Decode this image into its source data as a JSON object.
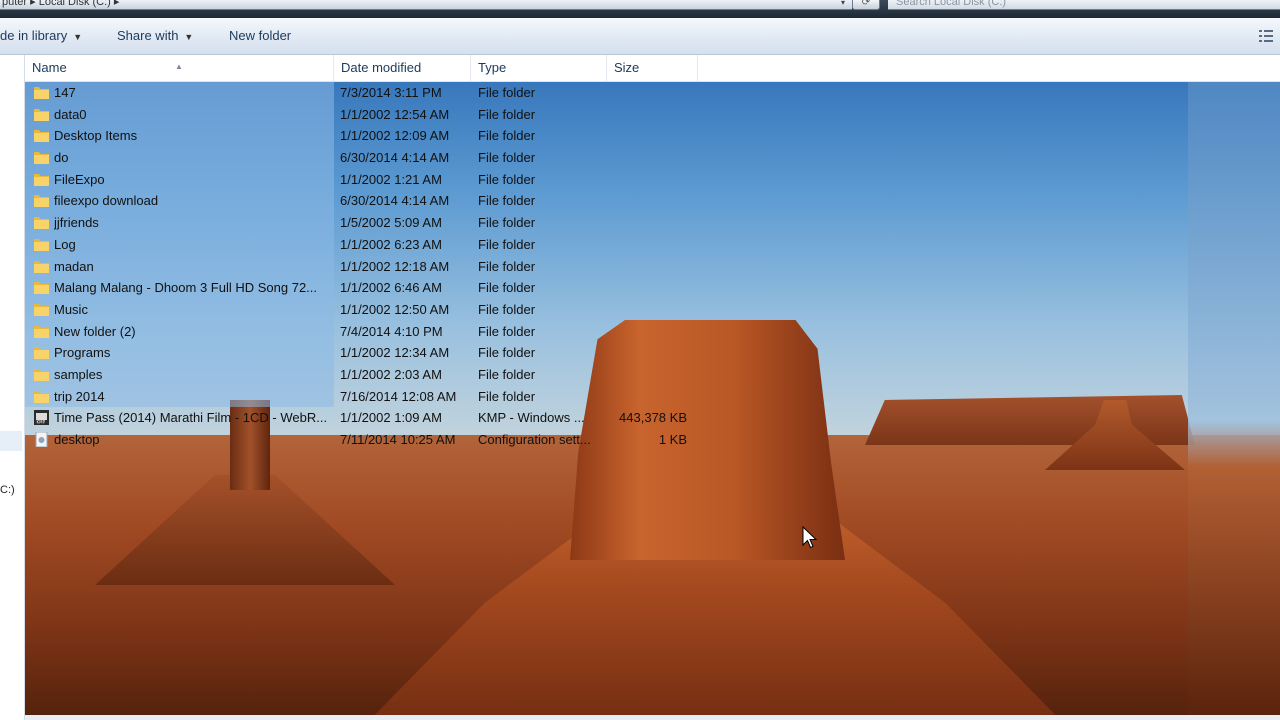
{
  "address": {
    "path_text": "puter ▸ Local Disk (C:) ▸",
    "search_placeholder": "Search Local Disk (C:)"
  },
  "toolbar": {
    "include_label": "de in library",
    "share_label": "Share with",
    "new_folder_label": "New folder"
  },
  "nav": {
    "drive_text": "C:)"
  },
  "columns": {
    "name": "Name",
    "date": "Date modified",
    "type": "Type",
    "size": "Size"
  },
  "files": [
    {
      "name": "147",
      "date": "7/3/2014 3:11 PM",
      "type": "File folder",
      "size": "",
      "icon": "folder-icon"
    },
    {
      "name": "data0",
      "date": "1/1/2002 12:54 AM",
      "type": "File folder",
      "size": "",
      "icon": "folder-icon"
    },
    {
      "name": "Desktop Items",
      "date": "1/1/2002 12:09 AM",
      "type": "File folder",
      "size": "",
      "icon": "folder-icon"
    },
    {
      "name": "do",
      "date": "6/30/2014 4:14 AM",
      "type": "File folder",
      "size": "",
      "icon": "folder-icon"
    },
    {
      "name": "FileExpo",
      "date": "1/1/2002 1:21 AM",
      "type": "File folder",
      "size": "",
      "icon": "folder-icon"
    },
    {
      "name": "fileexpo download",
      "date": "6/30/2014 4:14 AM",
      "type": "File folder",
      "size": "",
      "icon": "folder-icon"
    },
    {
      "name": "jjfriends",
      "date": "1/5/2002 5:09 AM",
      "type": "File folder",
      "size": "",
      "icon": "folder-icon"
    },
    {
      "name": "Log",
      "date": "1/1/2002 6:23 AM",
      "type": "File folder",
      "size": "",
      "icon": "folder-icon"
    },
    {
      "name": "madan",
      "date": "1/1/2002 12:18 AM",
      "type": "File folder",
      "size": "",
      "icon": "folder-icon"
    },
    {
      "name": "Malang Malang - Dhoom 3 Full HD Song 72...",
      "date": "1/1/2002 6:46 AM",
      "type": "File folder",
      "size": "",
      "icon": "folder-icon"
    },
    {
      "name": "Music",
      "date": "1/1/2002 12:50 AM",
      "type": "File folder",
      "size": "",
      "icon": "folder-icon"
    },
    {
      "name": "New folder (2)",
      "date": "7/4/2014 4:10 PM",
      "type": "File folder",
      "size": "",
      "icon": "folder-icon"
    },
    {
      "name": "Programs",
      "date": "1/1/2002 12:34 AM",
      "type": "File folder",
      "size": "",
      "icon": "folder-icon"
    },
    {
      "name": "samples",
      "date": "1/1/2002 2:03 AM",
      "type": "File folder",
      "size": "",
      "icon": "folder-icon"
    },
    {
      "name": "trip 2014",
      "date": "7/16/2014 12:08 AM",
      "type": "File folder",
      "size": "",
      "icon": "folder-icon"
    },
    {
      "name": "Time Pass (2014) Marathi Film - 1CD - WebR...",
      "date": "1/1/2002 1:09 AM",
      "type": "KMP - Windows ...",
      "size": "443,378 KB",
      "icon": "video-file-icon"
    },
    {
      "name": "desktop",
      "date": "7/11/2014 10:25 AM",
      "type": "Configuration sett...",
      "size": "1 KB",
      "icon": "config-file-icon"
    }
  ]
}
